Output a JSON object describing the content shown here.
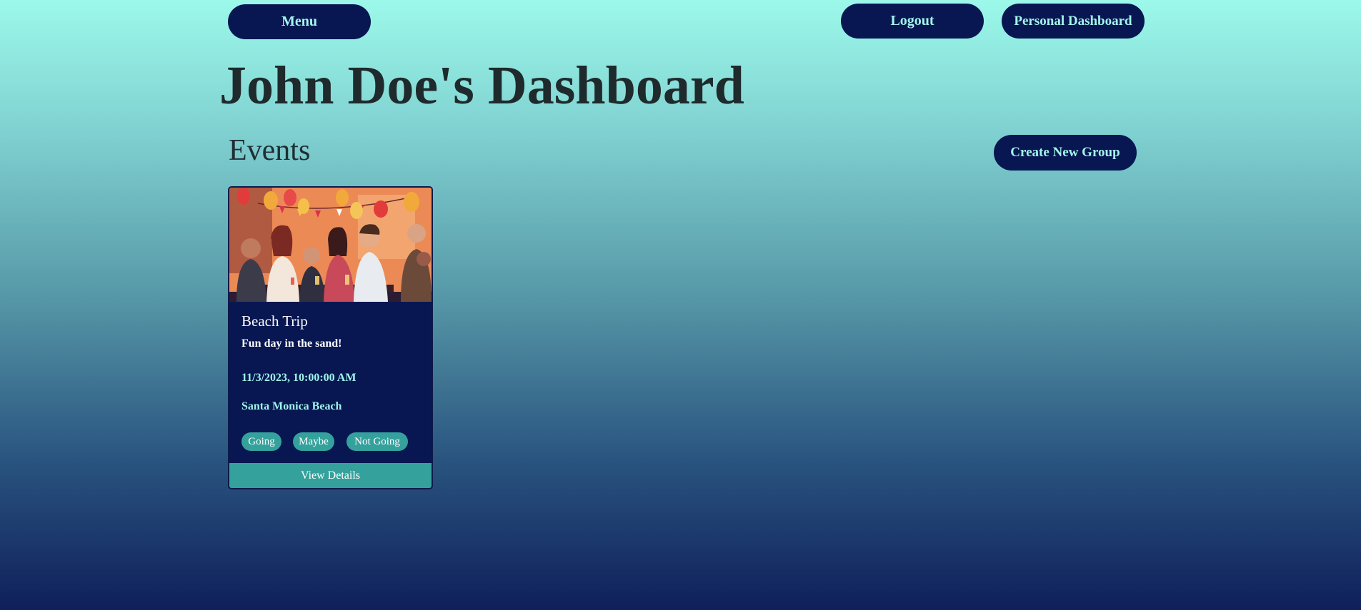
{
  "header": {
    "menu_label": "Menu",
    "logout_label": "Logout",
    "personal_dashboard_label": "Personal Dashboard"
  },
  "page": {
    "title": "John Doe's Dashboard",
    "section_title": "Events",
    "create_group_label": "Create New Group"
  },
  "events": [
    {
      "title": "Beach Trip",
      "description": "Fun day in the sand!",
      "datetime": "11/3/2023, 10:00:00 AM",
      "location": "Santa Monica Beach",
      "rsvp_options": [
        "Going",
        "Maybe",
        "Not Going"
      ],
      "details_label": "View Details",
      "image_icon": "party-illustration"
    }
  ],
  "colors": {
    "accent_dark": "#081752",
    "accent_teal": "#35a19c",
    "accent_light_text": "#a4f6ec",
    "gradient_top": "#9cf9ea",
    "gradient_bottom": "#0f1f5a"
  }
}
